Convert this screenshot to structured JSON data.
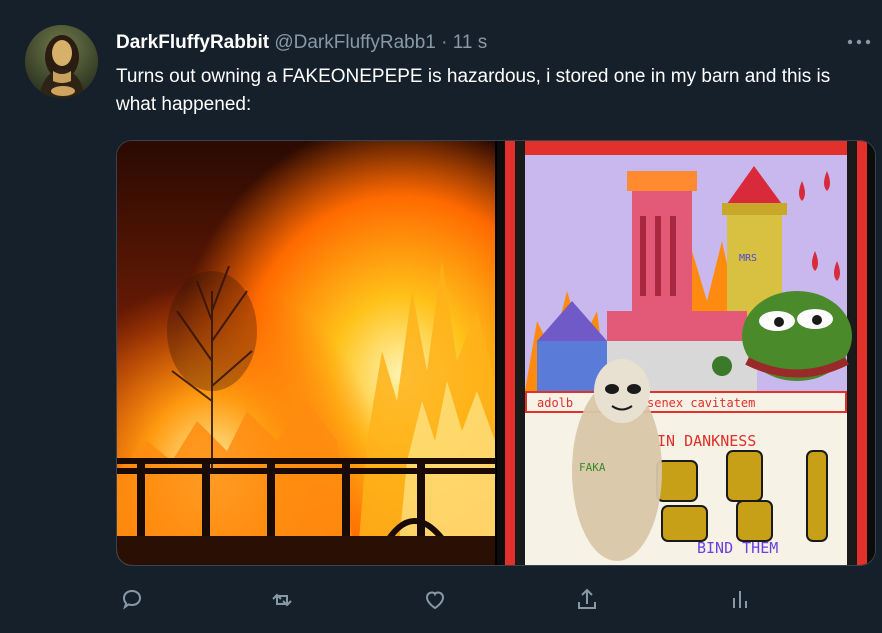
{
  "tweet": {
    "display_name": "DarkFluffyRabbit",
    "handle": "@DarkFluffyRabb1",
    "separator": "·",
    "timestamp": "11 s",
    "text": "Turns out owning a FAKEONEPEPE is hazardous, i stored one in my barn and this is what happened:",
    "avatar_icon": "mona-lisa-avatar",
    "more_icon": "more-horizontal-icon"
  },
  "media": {
    "left_image": "burning-barn-photo",
    "right_image": "fake-pepe-card-art",
    "card_texts": {
      "top_left": "adolb",
      "top_right": "senex cavitatem",
      "middle": "IN DANKNESS",
      "bottom": "BIND THEM",
      "vertical": "FAKA",
      "tower": "MRS"
    }
  },
  "actions": [
    {
      "icon": "reply-icon"
    },
    {
      "icon": "retweet-icon"
    },
    {
      "icon": "like-icon"
    },
    {
      "icon": "share-icon"
    },
    {
      "icon": "analytics-icon"
    }
  ],
  "colors": {
    "background": "#15202b",
    "primary_text": "#ffffff",
    "secondary_text": "#8899a6",
    "icon": "#8899a6",
    "border": "#38444d"
  }
}
